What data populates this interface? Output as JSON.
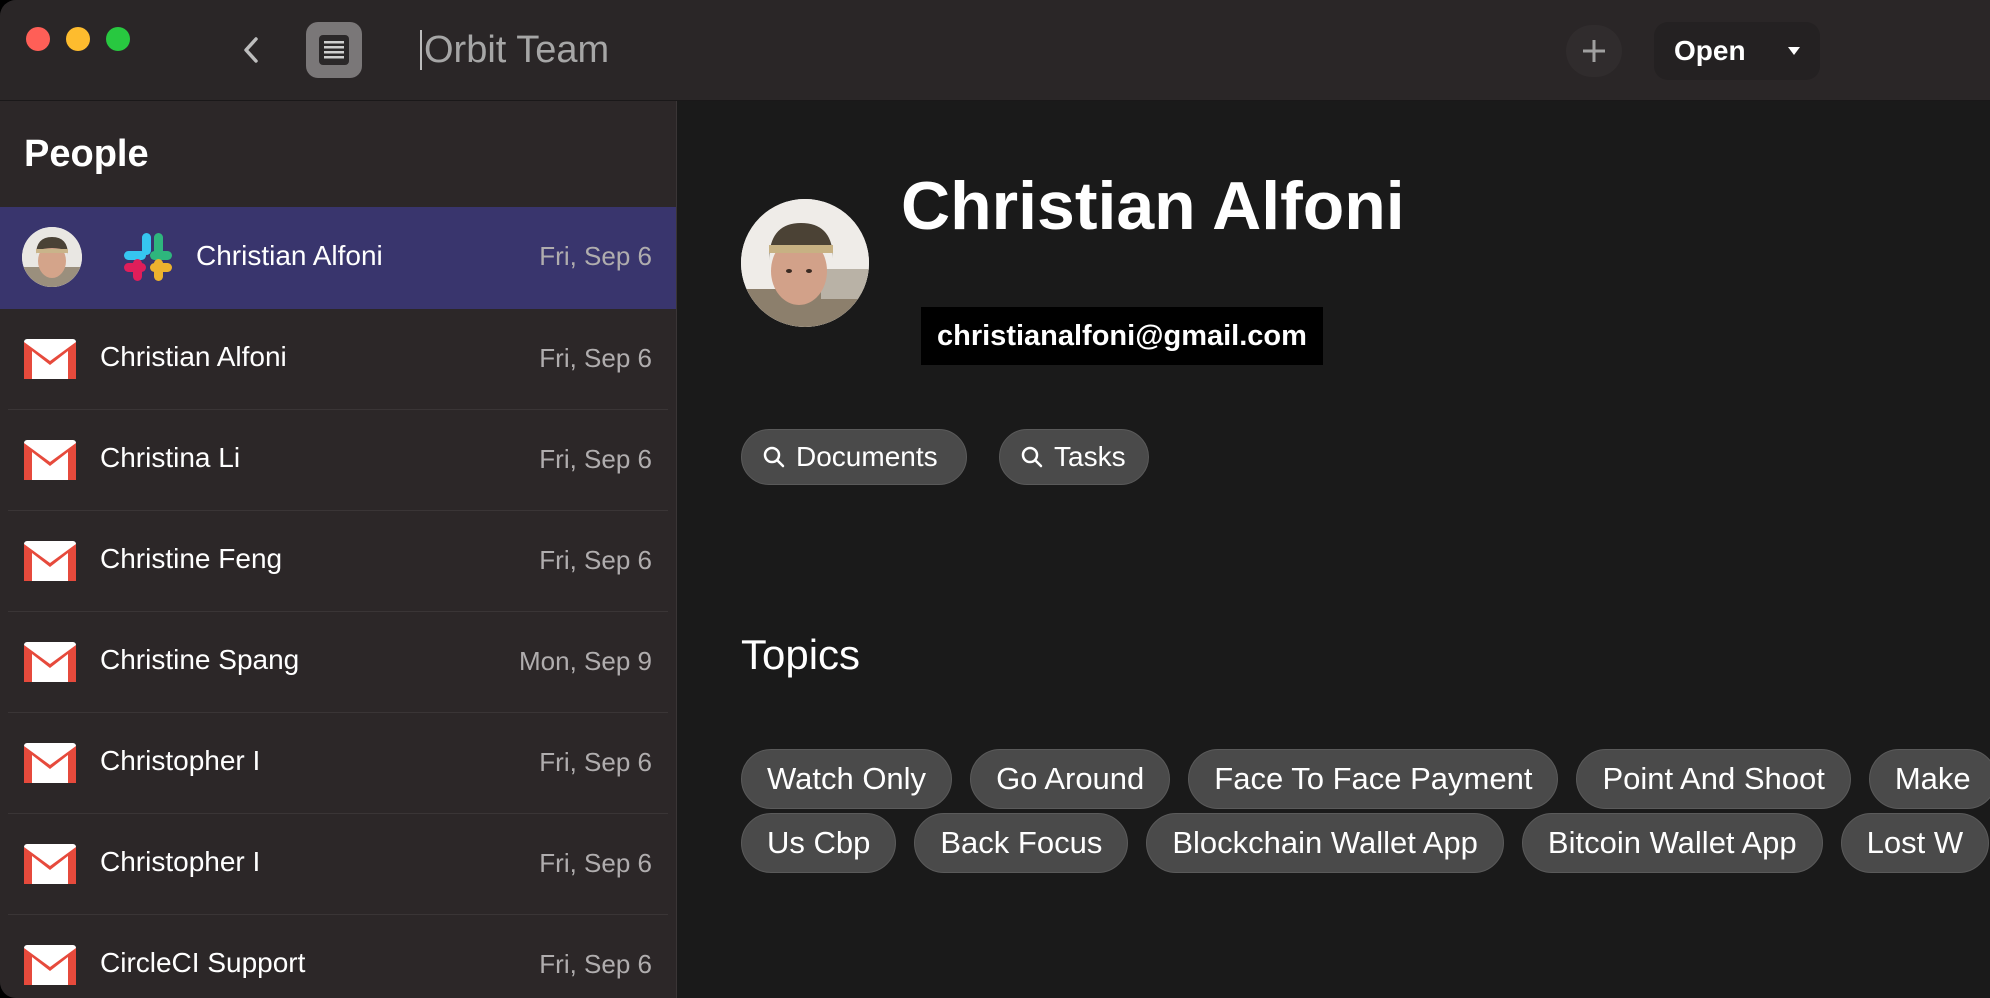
{
  "window": {
    "traffic_lights": [
      "close",
      "minimize",
      "zoom"
    ],
    "colors": {
      "close": "#ff5f57",
      "minimize": "#febc2e",
      "zoom": "#28c840"
    }
  },
  "toolbar": {
    "back_icon": "chevron-left-icon",
    "list_icon": "list-icon",
    "search_value": "Orbit Team",
    "plus_icon": "plus-icon",
    "open_label": "Open",
    "open_menu_icon": "caret-down-icon"
  },
  "sidebar": {
    "title": "People",
    "items": [
      {
        "name": "Christian Alfoni",
        "date": "Fri, Sep 6",
        "source": "slack",
        "selected": true
      },
      {
        "name": "Christian Alfoni",
        "date": "Fri, Sep 6",
        "source": "gmail"
      },
      {
        "name": "Christina Li",
        "date": "Fri, Sep 6",
        "source": "gmail"
      },
      {
        "name": "Christine Feng",
        "date": "Fri, Sep 6",
        "source": "gmail"
      },
      {
        "name": "Christine Spang",
        "date": "Mon, Sep 9",
        "source": "gmail"
      },
      {
        "name": "Christopher I",
        "date": "Fri, Sep 6",
        "source": "gmail"
      },
      {
        "name": "Christopher I",
        "date": "Fri, Sep 6",
        "source": "gmail"
      },
      {
        "name": "CircleCI Support",
        "date": "Fri, Sep 6",
        "source": "gmail"
      }
    ],
    "selected_color": "#39356d"
  },
  "profile": {
    "name": "Christian Alfoni",
    "email": "christianalfoni@gmail.com",
    "search_buttons": [
      "Documents",
      "Tasks"
    ],
    "topics_title": "Topics",
    "topics_row1": [
      "Watch Only",
      "Go Around",
      "Face To Face Payment",
      "Point And Shoot",
      "Make"
    ],
    "topics_row2": [
      "Us Cbp",
      "Back Focus",
      "Blockchain Wallet App",
      "Bitcoin Wallet App",
      "Lost W"
    ]
  }
}
